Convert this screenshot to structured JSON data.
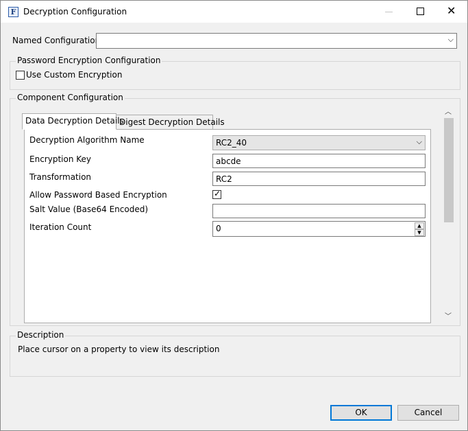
{
  "window": {
    "title": "Decryption Configuration",
    "app_icon_letter": "F",
    "controls": {
      "minimize": "—",
      "maximize": "☐",
      "close": "✕"
    }
  },
  "named_configuration": {
    "label": "Named Configuration",
    "value": ""
  },
  "password_encryption": {
    "group_title": "Password Encryption Configuration",
    "use_custom_label": "Use Custom Encryption",
    "use_custom_checked": false
  },
  "component": {
    "group_title": "Component Configuration",
    "tabs": [
      {
        "label": "Data Decryption Details",
        "active": true
      },
      {
        "label": "Digest Decryption Details",
        "active": false
      }
    ],
    "fields": {
      "algorithm": {
        "label": "Decryption Algorithm Name",
        "value": "RC2_40"
      },
      "key": {
        "label": "Encryption Key",
        "value": "abcde"
      },
      "transformation": {
        "label": "Transformation",
        "value": "RC2"
      },
      "allow_pbe": {
        "label": "Allow Password Based Encryption",
        "checked": true
      },
      "salt": {
        "label": "Salt Value (Base64 Encoded)",
        "value": ""
      },
      "iteration": {
        "label": "Iteration Count",
        "value": "0"
      }
    }
  },
  "description": {
    "group_title": "Description",
    "text": "Place cursor on a property to view its description"
  },
  "buttons": {
    "ok": "OK",
    "cancel": "Cancel"
  }
}
